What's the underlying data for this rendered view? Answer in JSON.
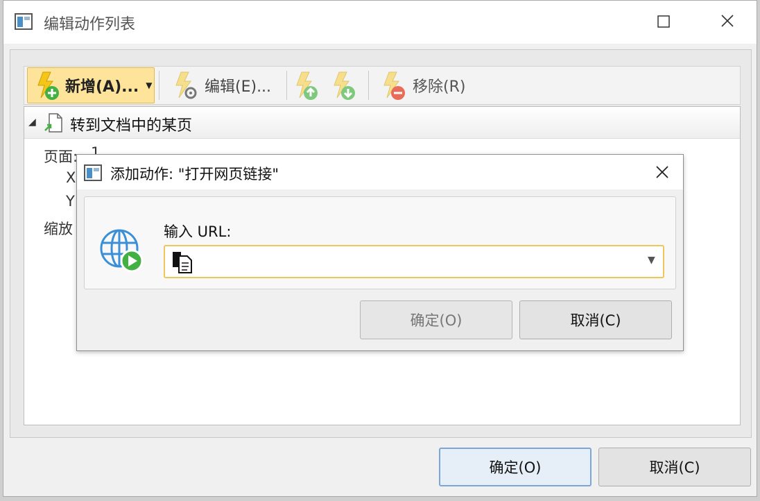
{
  "window": {
    "title": "编辑动作列表"
  },
  "toolbar": {
    "add_label": "新增(A)...",
    "edit_label": "编辑(E)...",
    "remove_label": "移除(R)"
  },
  "tree": {
    "node_label": "转到文档中的某页",
    "page_label": "页面:",
    "page_value": "1",
    "x_label": "X",
    "y_label": "Y",
    "zoom_label": "缩放"
  },
  "dialog": {
    "title": "添加动作: \"打开网页链接\"",
    "url_label": "输入 URL:",
    "url_value": "",
    "ok_label": "确定(O)",
    "cancel_label": "取消(C)"
  },
  "footer": {
    "ok_label": "确定(O)",
    "cancel_label": "取消(C)"
  },
  "icons": {
    "app": "window-app-icon",
    "add": "lightning-add-icon",
    "edit": "lightning-gear-icon",
    "up": "lightning-up-icon",
    "down": "lightning-down-icon",
    "remove": "lightning-remove-icon",
    "page": "page-goto-icon",
    "globe": "globe-play-icon",
    "doc": "document-icon"
  },
  "colors": {
    "accent_yellow": "#fde49a",
    "focus_blue": "#7aa7d8",
    "green": "#43b043",
    "red": "#e86c5a"
  }
}
